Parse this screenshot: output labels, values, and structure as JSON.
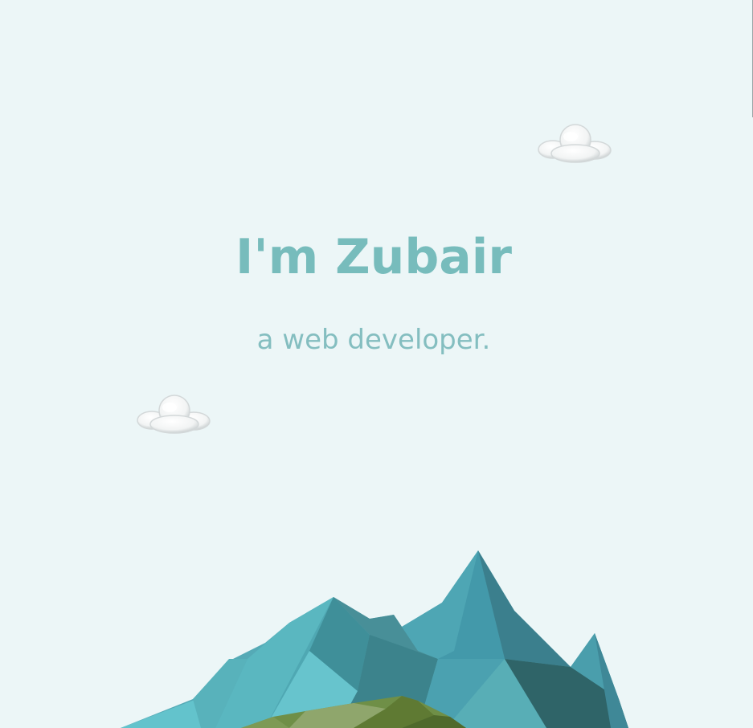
{
  "hero": {
    "title": "I'm Zubair",
    "subtitle": "a web developer."
  },
  "colors": {
    "background": "#ecf6f7",
    "title": "#77bcbc",
    "subtitle": "#84bec0"
  },
  "decorations": {
    "clouds": [
      "cloud-icon",
      "cloud-icon"
    ],
    "landscape": "low-poly-mountains-illustration"
  }
}
